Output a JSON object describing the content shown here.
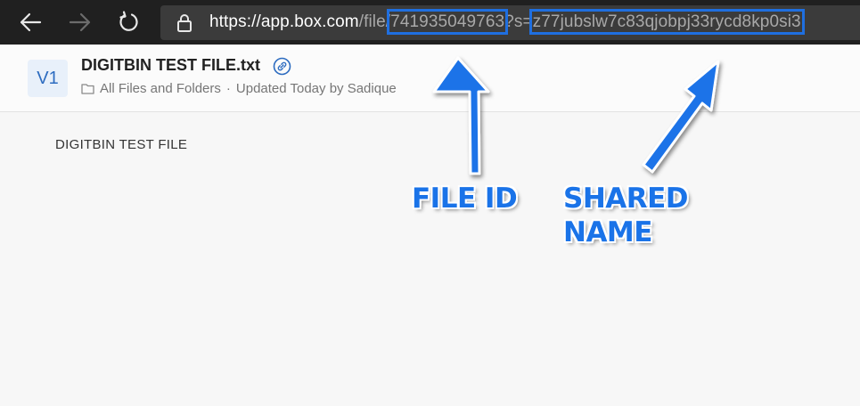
{
  "browser": {
    "back_icon": "arrow-left-icon",
    "forward_icon": "arrow-right-icon",
    "refresh_icon": "refresh-icon",
    "lock_icon": "lock-icon",
    "url": {
      "prefix": "https://",
      "host": "app.box.com",
      "path": "/file/",
      "file_id": "741935049763",
      "query_key": "?s=",
      "shared_name": "z77jubslw7c83qjobpj33rycd8kp0si3"
    }
  },
  "header": {
    "version_badge": "V1",
    "file_title": "DIGITBIN TEST FILE.txt",
    "folder_link": "All Files and Folders",
    "separator": "·",
    "updated_text": "Updated Today by Sadique"
  },
  "content": {
    "text": "DIGITBIN TEST FILE"
  },
  "annotations": {
    "file_id_label": "FILE ID",
    "shared_name_line1": "SHARED",
    "shared_name_line2": "NAME"
  },
  "colors": {
    "accent": "#1f6fe0",
    "annotation": "#1a73e8",
    "toolbar": "#202020",
    "addressbar": "#3b3b3b"
  }
}
